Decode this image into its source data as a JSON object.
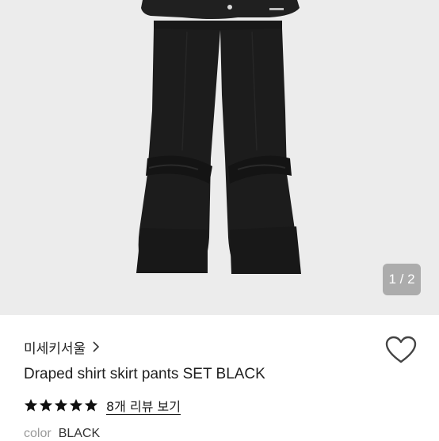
{
  "gallery": {
    "page_indicator": "1 / 2"
  },
  "product": {
    "brand": "미세키서울",
    "title": "Draped shirt skirt pants SET BLACK",
    "rating_stars": 5,
    "review_link": "8개 리뷰 보기",
    "color_label": "color",
    "color_value": "BLACK"
  },
  "icons": {
    "brand_chevron": "chevron-right-icon",
    "wishlist": "heart-outline-icon",
    "star": "star-filled-icon"
  },
  "colors": {
    "gallery_bg": "#ececec",
    "garment": "#1c1c1c",
    "star": "#111111",
    "indicator_bg": "#8a8a8a"
  }
}
